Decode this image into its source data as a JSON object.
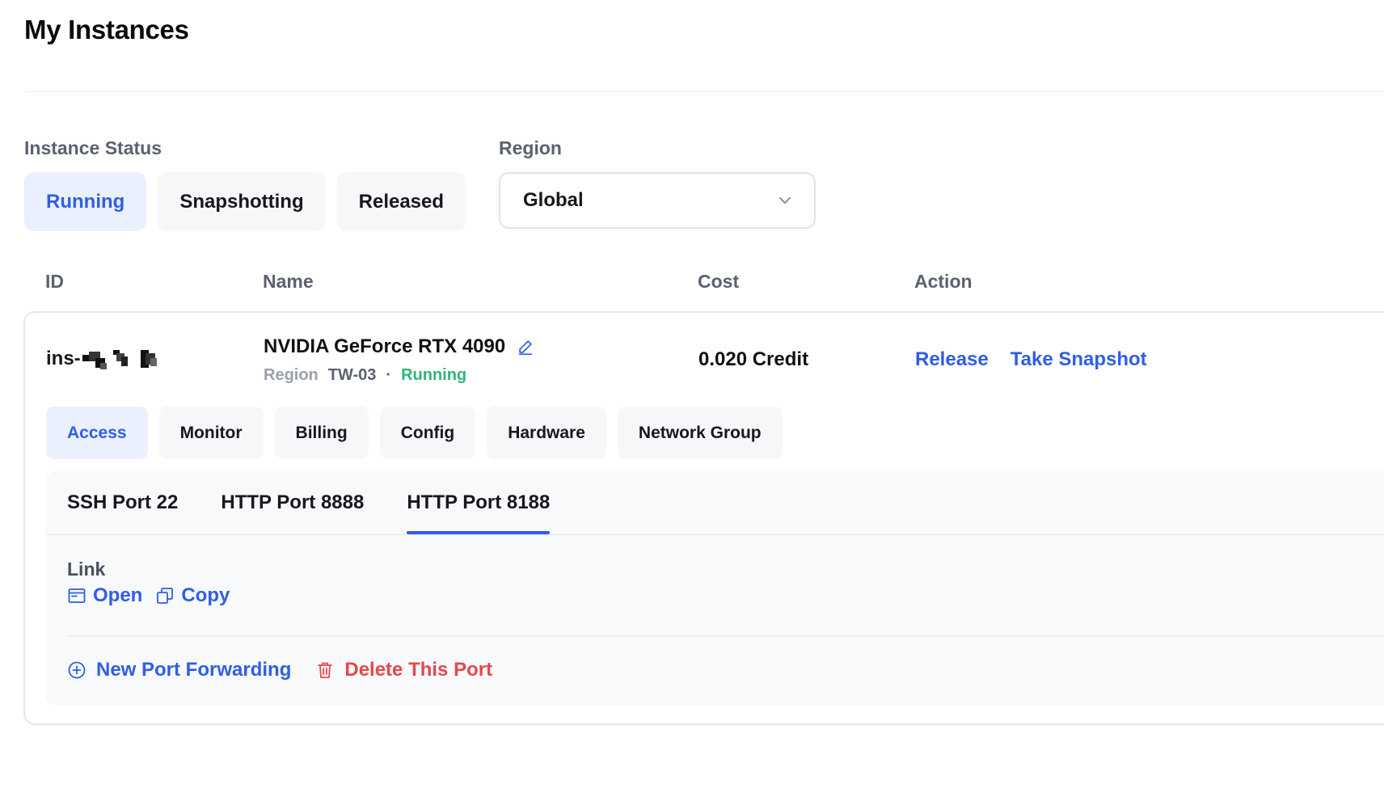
{
  "page": {
    "title": "My Instances"
  },
  "filters": {
    "status_label": "Instance Status",
    "status_options": [
      "Running",
      "Snapshotting",
      "Released"
    ],
    "status_selected": "Running",
    "region_label": "Region",
    "region_value": "Global"
  },
  "table": {
    "headers": {
      "id": "ID",
      "name": "Name",
      "cost": "Cost",
      "action": "Action"
    }
  },
  "instance": {
    "id_prefix": "ins-",
    "name": "NVIDIA GeForce RTX 4090",
    "region_label": "Region",
    "region": "TW-03",
    "separator": "·",
    "status": "Running",
    "cost": "0.020 Credit",
    "actions": {
      "release": "Release",
      "snapshot": "Take Snapshot"
    },
    "tabs": [
      "Access",
      "Monitor",
      "Billing",
      "Config",
      "Hardware",
      "Network Group"
    ],
    "active_tab": "Access",
    "access": {
      "ports": [
        "SSH Port 22",
        "HTTP Port 8888",
        "HTTP Port 8188"
      ],
      "active_port": "HTTP Port 8188",
      "link_label": "Link",
      "open_label": "Open",
      "copy_label": "Copy",
      "new_port_label": "New Port Forwarding",
      "delete_port_label": "Delete This Port"
    }
  },
  "colors": {
    "accent": "#2f5ee5",
    "running": "#34b27b",
    "danger": "#e5484d"
  },
  "icons": {
    "region_dropdown": "chevron-down-icon",
    "edit": "pencil-icon",
    "open": "browser-window-icon",
    "copy": "copy-icon",
    "new_port": "plus-circle-icon",
    "delete": "trash-icon"
  }
}
